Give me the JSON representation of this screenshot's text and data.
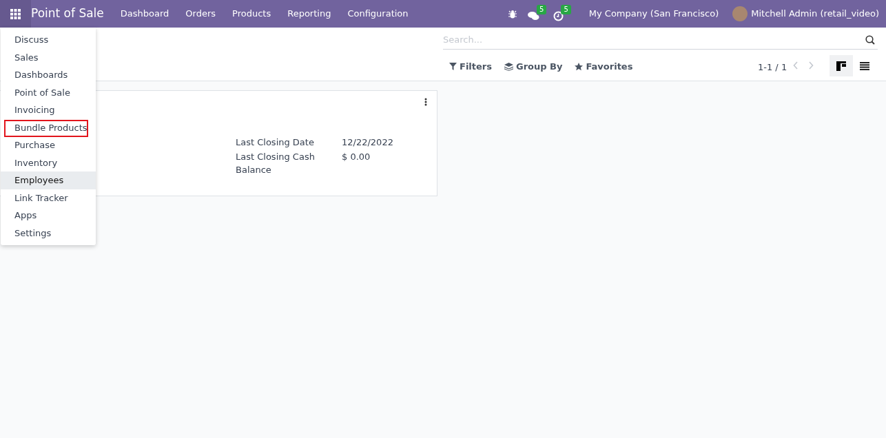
{
  "navbar": {
    "app_title": "Point of Sale",
    "menu": [
      "Dashboard",
      "Orders",
      "Products",
      "Reporting",
      "Configuration"
    ],
    "messages_badge": "5",
    "activities_badge": "5",
    "company": "My Company (San Francisco)",
    "user": "Mitchell Admin (retail_video)"
  },
  "apps_menu": {
    "items": [
      {
        "label": "Discuss",
        "hovered": false,
        "highlighted": false
      },
      {
        "label": "Sales",
        "hovered": false,
        "highlighted": false
      },
      {
        "label": "Dashboards",
        "hovered": false,
        "highlighted": false
      },
      {
        "label": "Point of Sale",
        "hovered": false,
        "highlighted": false
      },
      {
        "label": "Invoicing",
        "hovered": false,
        "highlighted": false
      },
      {
        "label": "Bundle Products",
        "hovered": false,
        "highlighted": true
      },
      {
        "label": "Purchase",
        "hovered": false,
        "highlighted": false
      },
      {
        "label": "Inventory",
        "hovered": false,
        "highlighted": false
      },
      {
        "label": "Employees",
        "hovered": true,
        "highlighted": false
      },
      {
        "label": "Link Tracker",
        "hovered": false,
        "highlighted": false
      },
      {
        "label": "Apps",
        "hovered": false,
        "highlighted": false
      },
      {
        "label": "Settings",
        "hovered": false,
        "highlighted": false
      }
    ]
  },
  "search": {
    "placeholder": "Search..."
  },
  "filters": [
    "Filters",
    "Group By",
    "Favorites"
  ],
  "pager": "1-1 / 1",
  "views": [
    {
      "kind": "kanban",
      "selected": true
    },
    {
      "kind": "list",
      "selected": false
    }
  ],
  "card": {
    "fields": [
      {
        "label": "Last Closing Date",
        "value": "12/22/2022"
      },
      {
        "label": "Last Closing Cash Balance",
        "value": "$ 0.00"
      }
    ]
  }
}
